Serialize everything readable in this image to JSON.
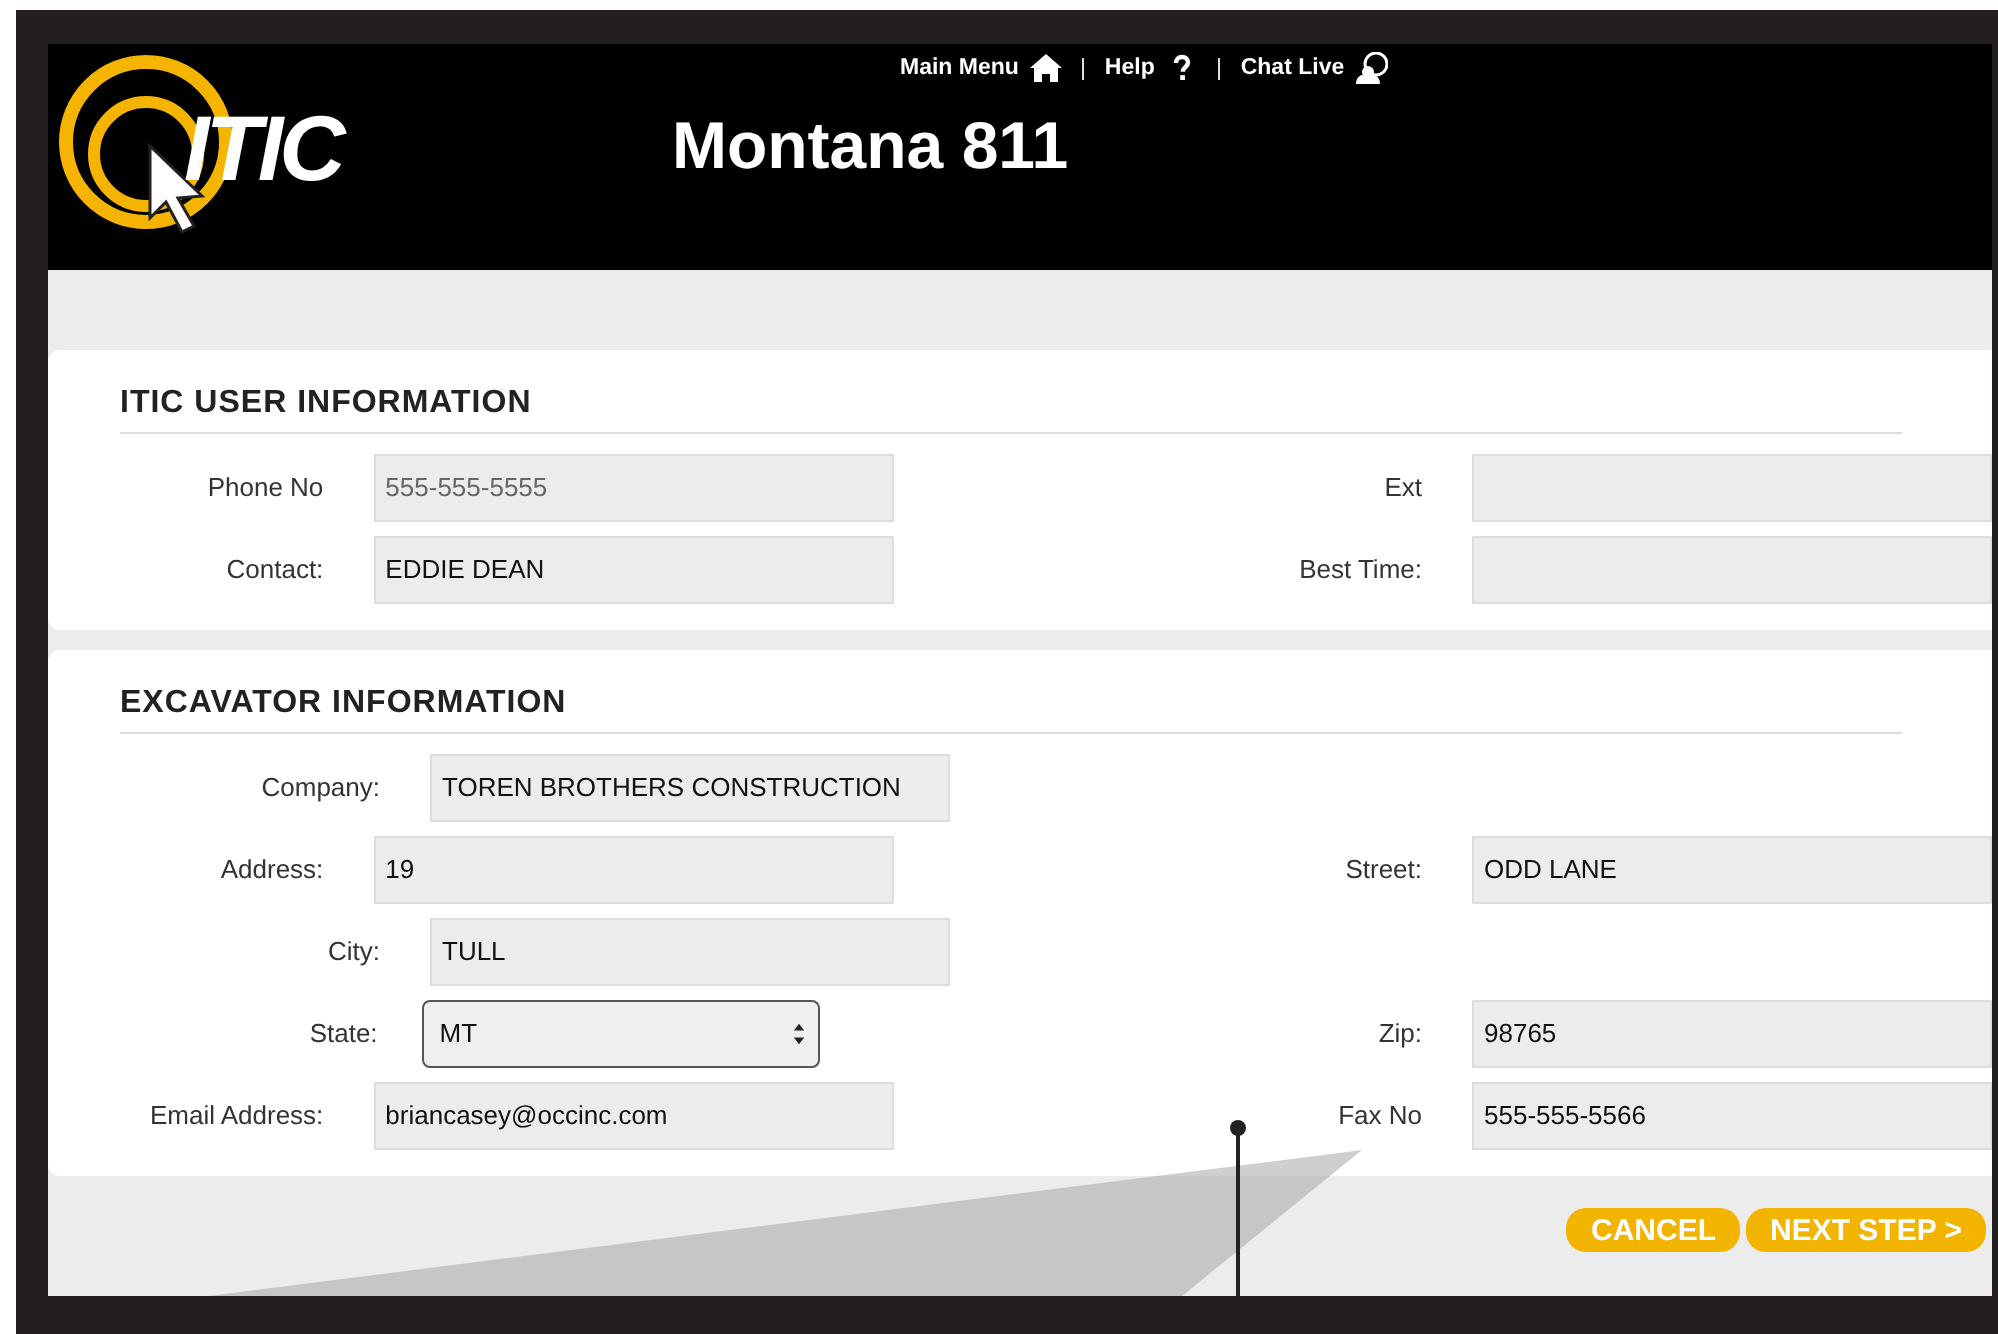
{
  "header": {
    "logo": "ITIC",
    "title": "Montana 811",
    "nav": [
      {
        "label": "Main Menu"
      },
      {
        "label": "Help"
      },
      {
        "label": "Chat Live"
      }
    ]
  },
  "sections": [
    {
      "title": "ITIC USER INFORMATION",
      "rows": [
        [
          {
            "label": "Phone No",
            "placeholder": "555-555-5555",
            "kind": "text"
          },
          {
            "label": "Ext",
            "kind": "text"
          }
        ],
        [
          {
            "label": "Contact:",
            "value": "EDDIE DEAN",
            "kind": "text"
          },
          {
            "label": "Best Time:",
            "kind": "text"
          }
        ]
      ]
    },
    {
      "title": "EXCAVATOR INFORMATION",
      "rows": [
        [
          {
            "label": "Company:",
            "value": "TOREN BROTHERS CONSTRUCTION",
            "kind": "text"
          }
        ],
        [
          {
            "label": "Address:",
            "value": "19",
            "kind": "text"
          },
          {
            "label": "Street:",
            "value": "ODD LANE",
            "kind": "text"
          }
        ],
        [
          {
            "label": "City:",
            "value": "TULL",
            "kind": "text"
          }
        ],
        [
          {
            "label": "State:",
            "value": "MT",
            "kind": "select"
          },
          {
            "label": "Zip:",
            "value": "98765",
            "kind": "text"
          }
        ],
        [
          {
            "label": "Email Address:",
            "value": "briancasey@occinc.com",
            "kind": "text"
          },
          {
            "label": "Fax No",
            "value": "555-555-5566",
            "kind": "text"
          }
        ]
      ]
    }
  ],
  "buttons": [
    "CANCEL",
    "NEXT STEP >"
  ]
}
